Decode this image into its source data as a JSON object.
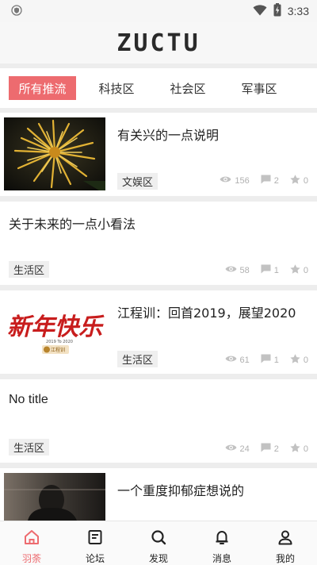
{
  "status_bar": {
    "time": "3:33",
    "icons": [
      "shield-icon",
      "wifi-icon",
      "battery-charging-icon"
    ]
  },
  "header": {
    "logo": "ZUCTU"
  },
  "tabs": [
    {
      "label": "所有推流",
      "active": true
    },
    {
      "label": "科技区",
      "active": false
    },
    {
      "label": "社会区",
      "active": false
    },
    {
      "label": "军事区",
      "active": false
    }
  ],
  "posts": [
    {
      "title": "有关兴的一点说明",
      "tag": "文娱区",
      "views": "156",
      "comments": "2",
      "likes": "0",
      "thumbnail": "chrysanthemum-photo"
    },
    {
      "title": "关于未来的一点小看法",
      "tag": "生活区",
      "views": "58",
      "comments": "1",
      "likes": "0"
    },
    {
      "title": "江程训：回首2019，展望2020",
      "tag": "生活区",
      "views": "61",
      "comments": "1",
      "likes": "0",
      "thumbnail": "new-year-banner",
      "thumb_text": {
        "headline": "新年快乐",
        "sub": "2019 To 2020",
        "badge": "江程训"
      }
    },
    {
      "title": "No title",
      "tag": "生活区",
      "views": "24",
      "comments": "2",
      "likes": "0"
    },
    {
      "title": "一个重度抑郁症想说的",
      "thumbnail": "dark-portrait-photo"
    }
  ],
  "bottom_nav": [
    {
      "label": "羽荼",
      "icon": "home-icon",
      "active": true
    },
    {
      "label": "论坛",
      "icon": "forum-icon",
      "active": false
    },
    {
      "label": "发现",
      "icon": "discover-icon",
      "active": false
    },
    {
      "label": "消息",
      "icon": "bell-icon",
      "active": false
    },
    {
      "label": "我的",
      "icon": "profile-icon",
      "active": false
    }
  ],
  "colors": {
    "accent": "#ed6b6f",
    "page_bg": "#ededed",
    "tag_bg": "#efefef",
    "stat_gray": "#b0b0b0"
  }
}
